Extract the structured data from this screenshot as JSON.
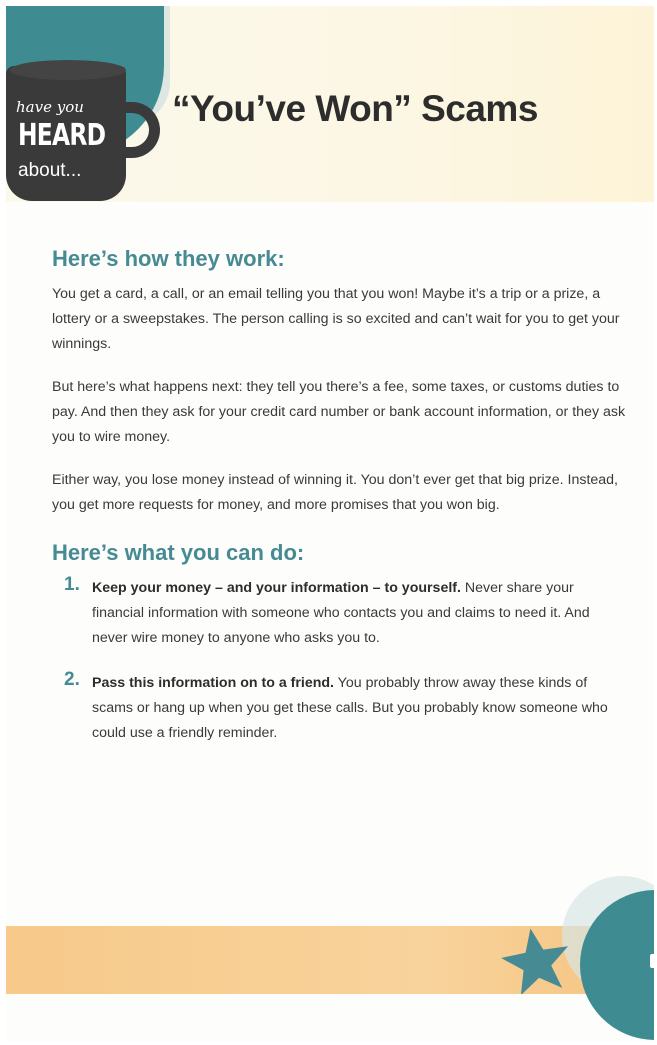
{
  "badge": {
    "line1": "have you",
    "line2": "HEARD",
    "line3": "about..."
  },
  "title": "“You’ve Won” Scams",
  "section1": {
    "heading": "Here’s how they work:",
    "paragraphs": [
      "You get a card, a call, or an email telling you that you won! Maybe it’s a trip or a prize, a lottery or a sweepstakes. The person calling is so excited and can’t wait for you to get your winnings.",
      "But here’s what happens next: they tell you there’s a fee, some taxes, or customs duties to pay. And then they ask for your credit card number or bank account information, or they ask you to wire money.",
      "Either way, you lose money instead of winning it. You don’t ever get that big prize. Instead, you get more requests for money, and more promises that you won big."
    ]
  },
  "section2": {
    "heading": "Here’s what you can do:",
    "steps": [
      {
        "number": "1.",
        "lead": "Keep your money – and your information – to yourself.",
        "text": " Never share your financial information with someone who contacts you and claims to need it. And never wire money to anyone who asks you to."
      },
      {
        "number": "2.",
        "lead": "Pass this information on to a friend.",
        "text": " You probably throw away these kinds of scams or hang up when you get these calls. But you probably know someone who could use a friendly reminder."
      }
    ]
  },
  "icons": {
    "mug": "coffee-mug-icon",
    "star": "star-icon"
  },
  "colors": {
    "accent_teal": "#468a93",
    "mug_dark": "#3a3a3a",
    "footer_orange": "#f7c98a"
  }
}
